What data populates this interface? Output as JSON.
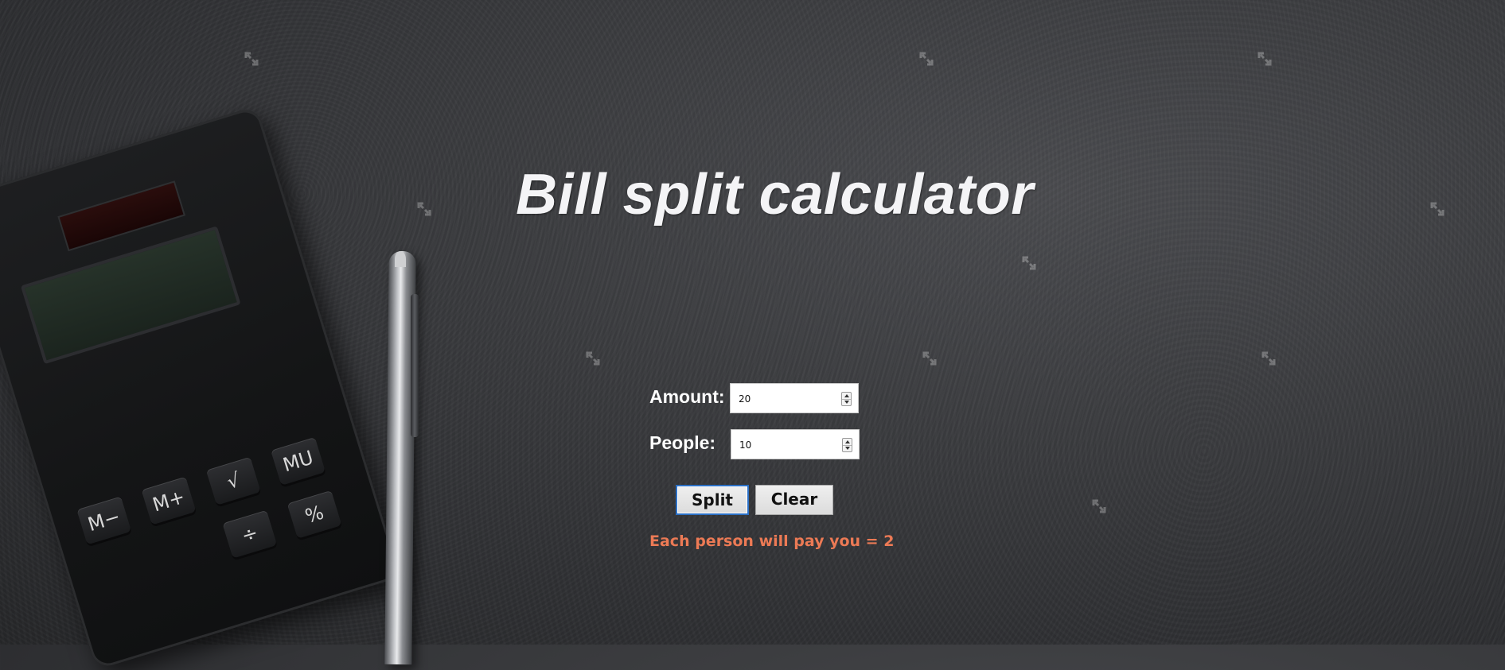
{
  "page": {
    "title": "Bill split calculator"
  },
  "form": {
    "amount_label": "Amount:",
    "amount_value": "20",
    "people_label": "People:",
    "people_value": "10"
  },
  "buttons": {
    "split_label": "Split",
    "clear_label": "Clear"
  },
  "result": {
    "text": "Each person will pay you = 2"
  },
  "background": {
    "calculator_keys": [
      "MU",
      "√",
      "M+",
      "M−",
      "%",
      "÷"
    ],
    "watermark_icon": "resize-watermark-icon"
  },
  "colors": {
    "background": "#3c3d40",
    "title": "#f4f4f6",
    "label": "#ffffff",
    "result": "#ec7a55",
    "focus_ring": "#2b6fc4"
  }
}
